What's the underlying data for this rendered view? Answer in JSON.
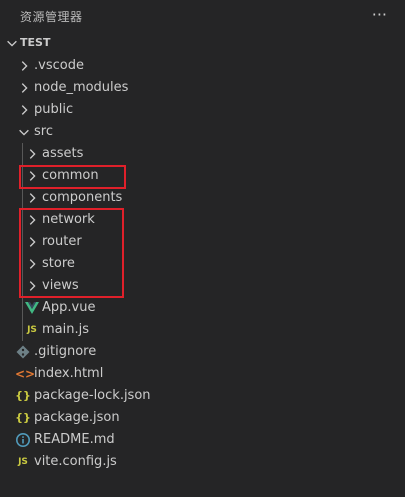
{
  "explorer": {
    "title": "资源管理器",
    "more": "···",
    "section": "TEST"
  },
  "tree": [
    {
      "label": ".vscode",
      "type": "folder",
      "icon": "chevron-right-icon"
    },
    {
      "label": "node_modules",
      "type": "folder",
      "icon": "chevron-right-icon"
    },
    {
      "label": "public",
      "type": "folder",
      "icon": "chevron-right-icon"
    },
    {
      "label": "src",
      "type": "folder-open",
      "icon": "chevron-down-icon"
    },
    {
      "label": "assets",
      "type": "folder",
      "icon": "chevron-right-icon"
    },
    {
      "label": "common",
      "type": "folder",
      "icon": "chevron-right-icon"
    },
    {
      "label": "components",
      "type": "folder",
      "icon": "chevron-right-icon"
    },
    {
      "label": "network",
      "type": "folder",
      "icon": "chevron-right-icon"
    },
    {
      "label": "router",
      "type": "folder",
      "icon": "chevron-right-icon"
    },
    {
      "label": "store",
      "type": "folder",
      "icon": "chevron-right-icon"
    },
    {
      "label": "views",
      "type": "folder",
      "icon": "chevron-right-icon"
    },
    {
      "label": "App.vue",
      "type": "file",
      "icon": "vue-icon"
    },
    {
      "label": "main.js",
      "type": "file",
      "icon": "javascript-icon",
      "glyph": "JS"
    },
    {
      "label": ".gitignore",
      "type": "file",
      "icon": "git-icon"
    },
    {
      "label": "index.html",
      "type": "file",
      "icon": "html-icon",
      "glyph": "<>"
    },
    {
      "label": "package-lock.json",
      "type": "file",
      "icon": "json-icon",
      "glyph": "{}"
    },
    {
      "label": "package.json",
      "type": "file",
      "icon": "json-icon",
      "glyph": "{}"
    },
    {
      "label": "README.md",
      "type": "file",
      "icon": "info-icon",
      "glyph": "i"
    },
    {
      "label": "vite.config.js",
      "type": "file",
      "icon": "javascript-icon",
      "glyph": "JS"
    }
  ],
  "colors": {
    "background": "#252526",
    "text": "#cccccc",
    "highlight_box": "#e0202a",
    "vue": "#41b883",
    "js": "#cbcb41",
    "html": "#e37933",
    "json": "#cbcb41",
    "info": "#519aba",
    "git": "#6d8086"
  }
}
